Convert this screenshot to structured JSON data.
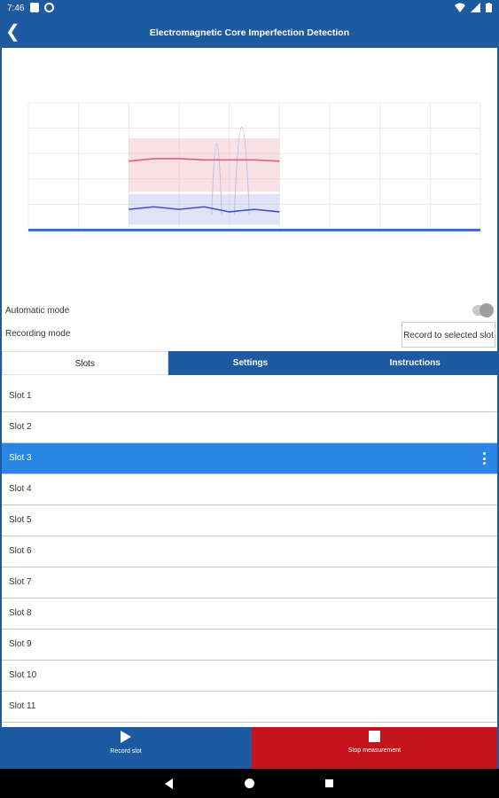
{
  "status_bar": {
    "time": "7:46"
  },
  "header": {
    "title": "Electromagnetic Core Imperfection Detection"
  },
  "controls": {
    "automatic_mode_label": "Automatic mode",
    "recording_mode_label": "Recording mode",
    "record_button_label": "Record to selected slot"
  },
  "tabs": [
    {
      "label": "Slots"
    },
    {
      "label": "Settings"
    },
    {
      "label": "Instructions"
    }
  ],
  "slots": [
    "Slot 1",
    "Slot 2",
    "Slot 3",
    "Slot 4",
    "Slot 5",
    "Slot 6",
    "Slot 7",
    "Slot 8",
    "Slot 9",
    "Slot 10",
    "Slot 11"
  ],
  "selected_slot": "Slot 3",
  "bottom": {
    "record_label": "Record slot",
    "stop_label": "Stop measurement"
  },
  "colors": {
    "primary": "#1e5aa0",
    "selected": "#2a86e4",
    "stop": "#c4141c",
    "red_series": "#e0607a",
    "blue_series": "#3f4fd0"
  },
  "chart_data": {
    "type": "line",
    "x_range": [
      0,
      9
    ],
    "y_range": [
      0,
      5
    ],
    "grid": true,
    "series": [
      {
        "x": [
          2.0,
          2.5,
          3.0,
          3.5,
          4.0,
          4.5,
          5.0
        ],
        "y": [
          2.7,
          2.8,
          2.8,
          2.75,
          2.75,
          2.75,
          2.7
        ]
      },
      {
        "x": [
          2.0,
          2.5,
          3.0,
          3.5,
          4.0,
          4.5,
          5.0
        ],
        "y": [
          0.8,
          0.9,
          0.8,
          0.9,
          0.7,
          0.8,
          0.7
        ]
      }
    ]
  }
}
